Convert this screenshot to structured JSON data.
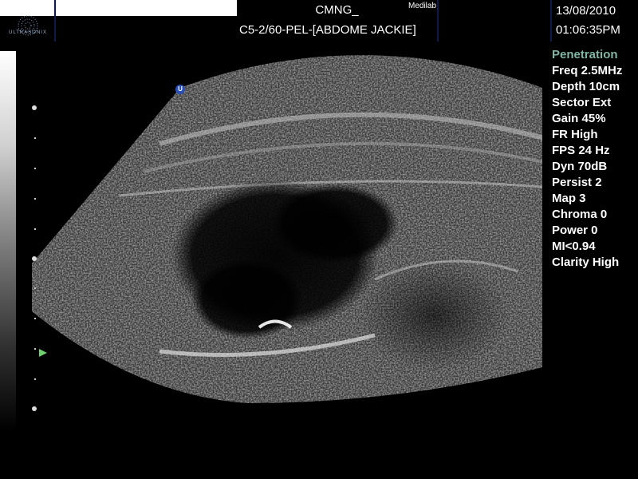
{
  "header": {
    "site": "CMNG_",
    "brand": "Medilab",
    "probe_preset": "C5-2/60-PEL-[ABDOME JACKIE]",
    "date": "13/08/2010",
    "time": "01:06:35PM",
    "logo_text": "ULTRASONIX"
  },
  "params": [
    {
      "label": "Penetration",
      "accent": true
    },
    {
      "label": "Freq 2.5MHz"
    },
    {
      "label": "Depth 10cm"
    },
    {
      "label": "Sector Ext"
    },
    {
      "label": "Gain 45%"
    },
    {
      "label": "FR High"
    },
    {
      "label": "FPS 24 Hz"
    },
    {
      "label": "Dyn 70dB"
    },
    {
      "label": "Persist 2"
    },
    {
      "label": "Map 3"
    },
    {
      "label": "Chroma 0"
    },
    {
      "label": "Power 0"
    },
    {
      "label": "MI<0.94"
    },
    {
      "label": "Clarity High"
    }
  ],
  "orientation_marker": "U",
  "colors": {
    "accent_param": "#80b6a4",
    "focus_marker": "#6fd06f",
    "orientation_marker": "#2a4fb8",
    "separator": "#0d1a4a"
  }
}
